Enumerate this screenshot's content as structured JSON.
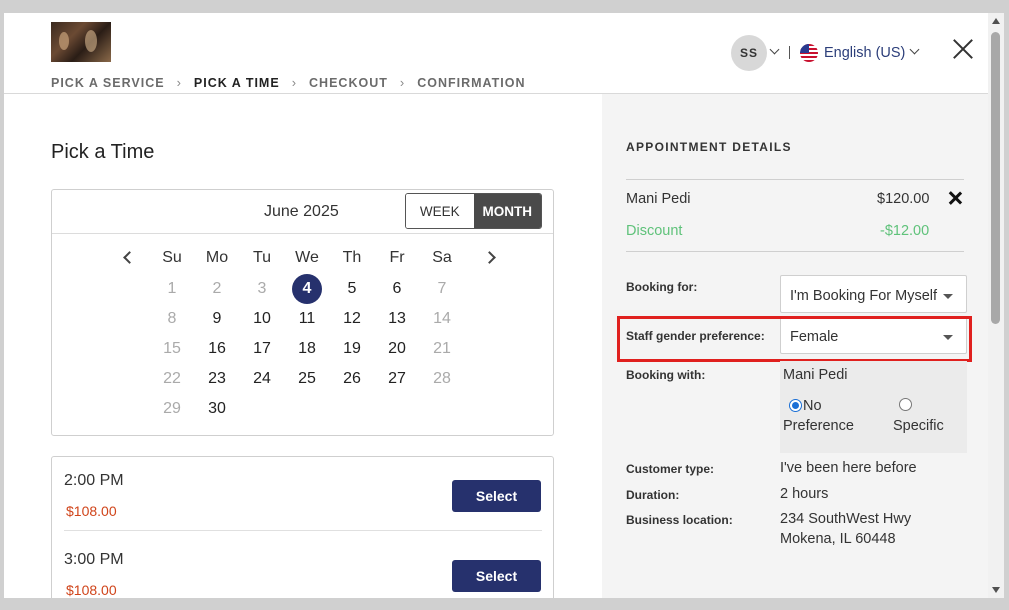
{
  "header": {
    "logo_alt": "Salon logo",
    "breadcrumb": [
      "PICK A SERVICE",
      "PICK A TIME",
      "CHECKOUT",
      "CONFIRMATION"
    ],
    "active_step": 1,
    "user_initials": "SS",
    "language": "English (US)"
  },
  "main": {
    "title": "Pick a Time",
    "calendar": {
      "month_label": "June 2025",
      "view_week": "WEEK",
      "view_month": "MONTH",
      "active_view": "MONTH",
      "weekdays": [
        "Su",
        "Mo",
        "Tu",
        "We",
        "Th",
        "Fr",
        "Sa"
      ],
      "selected_day": "4",
      "weeks": [
        [
          {
            "d": "1",
            "dim": true
          },
          {
            "d": "2",
            "dim": true
          },
          {
            "d": "3",
            "dim": true
          },
          {
            "d": "4",
            "dim": false,
            "sel": true
          },
          {
            "d": "5",
            "dim": false
          },
          {
            "d": "6",
            "dim": false
          },
          {
            "d": "7",
            "dim": true
          }
        ],
        [
          {
            "d": "8",
            "dim": true
          },
          {
            "d": "9",
            "dim": false
          },
          {
            "d": "10",
            "dim": false
          },
          {
            "d": "11",
            "dim": false
          },
          {
            "d": "12",
            "dim": false
          },
          {
            "d": "13",
            "dim": false
          },
          {
            "d": "14",
            "dim": true
          }
        ],
        [
          {
            "d": "15",
            "dim": true
          },
          {
            "d": "16",
            "dim": false
          },
          {
            "d": "17",
            "dim": false
          },
          {
            "d": "18",
            "dim": false
          },
          {
            "d": "19",
            "dim": false
          },
          {
            "d": "20",
            "dim": false
          },
          {
            "d": "21",
            "dim": true
          }
        ],
        [
          {
            "d": "22",
            "dim": true
          },
          {
            "d": "23",
            "dim": false
          },
          {
            "d": "24",
            "dim": false
          },
          {
            "d": "25",
            "dim": false
          },
          {
            "d": "26",
            "dim": false
          },
          {
            "d": "27",
            "dim": false
          },
          {
            "d": "28",
            "dim": true
          }
        ],
        [
          {
            "d": "29",
            "dim": true
          },
          {
            "d": "30",
            "dim": false
          }
        ]
      ]
    },
    "slots": [
      {
        "time": "2:00 PM",
        "price": "$108.00",
        "button": "Select"
      },
      {
        "time": "3:00 PM",
        "price": "$108.00",
        "button": "Select"
      }
    ]
  },
  "details": {
    "title": "APPOINTMENT DETAILS",
    "service_name": "Mani Pedi",
    "service_price": "$120.00",
    "discount_label": "Discount",
    "discount_value": "-$12.00",
    "booking_for_label": "Booking for:",
    "booking_for_value": "I'm Booking For Myself",
    "gender_label": "Staff gender preference:",
    "gender_value": "Female",
    "booking_with_label": "Booking with:",
    "booking_with_service": "Mani Pedi",
    "option_no_pref": "No Preference",
    "option_no_pref_line1": "No",
    "option_no_pref_line2": "Preference",
    "option_specific": "Specific",
    "customer_type_label": "Customer type:",
    "customer_type_value": "I've been here before",
    "duration_label": "Duration:",
    "duration_value": "2 hours",
    "location_label": "Business location:",
    "location_line1": "234 SouthWest Hwy",
    "location_line2": "Mokena, IL 60448"
  },
  "colors": {
    "primary": "#26316d",
    "discount": "#5fc27a",
    "price": "#d0441a",
    "highlight": "#e0201e"
  }
}
